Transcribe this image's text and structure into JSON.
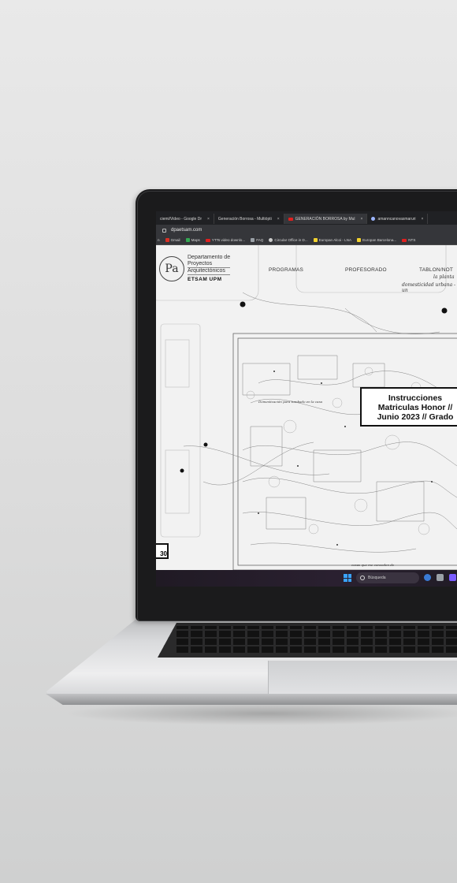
{
  "browser": {
    "tabs": [
      {
        "label": "ciemi/Video - Google Dr",
        "close": "×",
        "icon": "drive-icon"
      },
      {
        "label": "Generación Borrosa - Multiópti",
        "close": "×",
        "icon": "page-icon"
      },
      {
        "label": "GENERACIÓN BORROSA by Mul",
        "close": "×",
        "icon": "youtube-icon"
      },
      {
        "label": "amanncanovasmaruri",
        "close": "×",
        "icon": "profile-icon"
      }
    ],
    "url": "dpaetsam.com",
    "bookmarks": [
      {
        "label": "n",
        "icon": "generic-icon"
      },
      {
        "label": "Gmail",
        "icon": "gmail-icon"
      },
      {
        "label": "Maps",
        "icon": "maps-icon"
      },
      {
        "label": "YTTs video downlo...",
        "icon": "youtube-icon"
      },
      {
        "label": "FAQ",
        "icon": "faq-icon"
      },
      {
        "label": "Circular Office in D...",
        "icon": "globe-icon"
      },
      {
        "label": "Europan Alcoi - LNA",
        "icon": "folder-icon"
      },
      {
        "label": "Europan Barcelona...",
        "icon": "folder-icon"
      },
      {
        "label": "NTS",
        "icon": "youtube-icon"
      }
    ]
  },
  "site": {
    "logo_letters": "Pa",
    "dept_line1": "Departamento de",
    "dept_line2": "Proyectos",
    "dept_line3": "Arquitectónicos",
    "school": "ETSAM UPM",
    "nav": [
      "PROGRAMAS",
      "PROFESORADO",
      "TABLON/NOT"
    ],
    "script_lines": [
      "la planta",
      "domesticidad urbana - un"
    ],
    "plan_note": "Domesticación para tumbado en la casa",
    "plan_note2": "cosas que me conceden de",
    "card_lines": [
      "Instrucciones",
      "Matriculas Honor //",
      "Junio 2023 // Grado"
    ],
    "badge": "30"
  },
  "taskbar": {
    "search_placeholder": "Búsqueda"
  },
  "colors": {
    "youtube": "#e0201f",
    "windows": "#3aa3ff",
    "chrome_dark": "#202124"
  }
}
